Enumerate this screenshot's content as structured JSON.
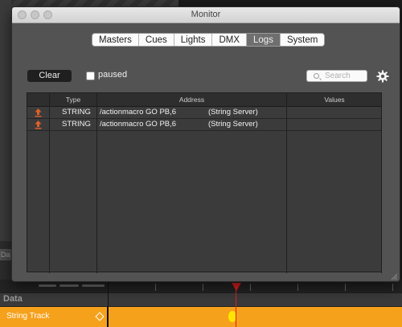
{
  "window": {
    "title": "Monitor",
    "tabs": [
      {
        "label": "Masters",
        "active": false
      },
      {
        "label": "Cues",
        "active": false
      },
      {
        "label": "Lights",
        "active": false
      },
      {
        "label": "DMX",
        "active": false
      },
      {
        "label": "Logs",
        "active": true
      },
      {
        "label": "System",
        "active": false
      }
    ],
    "clear_label": "Clear",
    "paused_label": "paused",
    "paused_checked": false,
    "search_placeholder": "Search",
    "search_value": "",
    "settings_icon": "gear-icon"
  },
  "log_table": {
    "columns": [
      "Type",
      "Address",
      "Values"
    ],
    "rows": [
      {
        "icon": "outgoing-arrow-icon",
        "type": "STRING",
        "address": "/actionmacro GO PB,6",
        "source": "(String Server)",
        "values": ""
      },
      {
        "icon": "outgoing-arrow-icon",
        "type": "STRING",
        "address": "/actionmacro GO PB,6",
        "source": "(String Server)",
        "values": ""
      }
    ]
  },
  "timeline": {
    "partial_tab": "Da",
    "section_label": "Data",
    "track": {
      "name": "String Track"
    }
  },
  "colors": {
    "track_orange": "#f5a11c",
    "playhead_red": "#e32020",
    "keyframe_yellow": "#ffe600",
    "arrow_orange": "#e0602a"
  }
}
